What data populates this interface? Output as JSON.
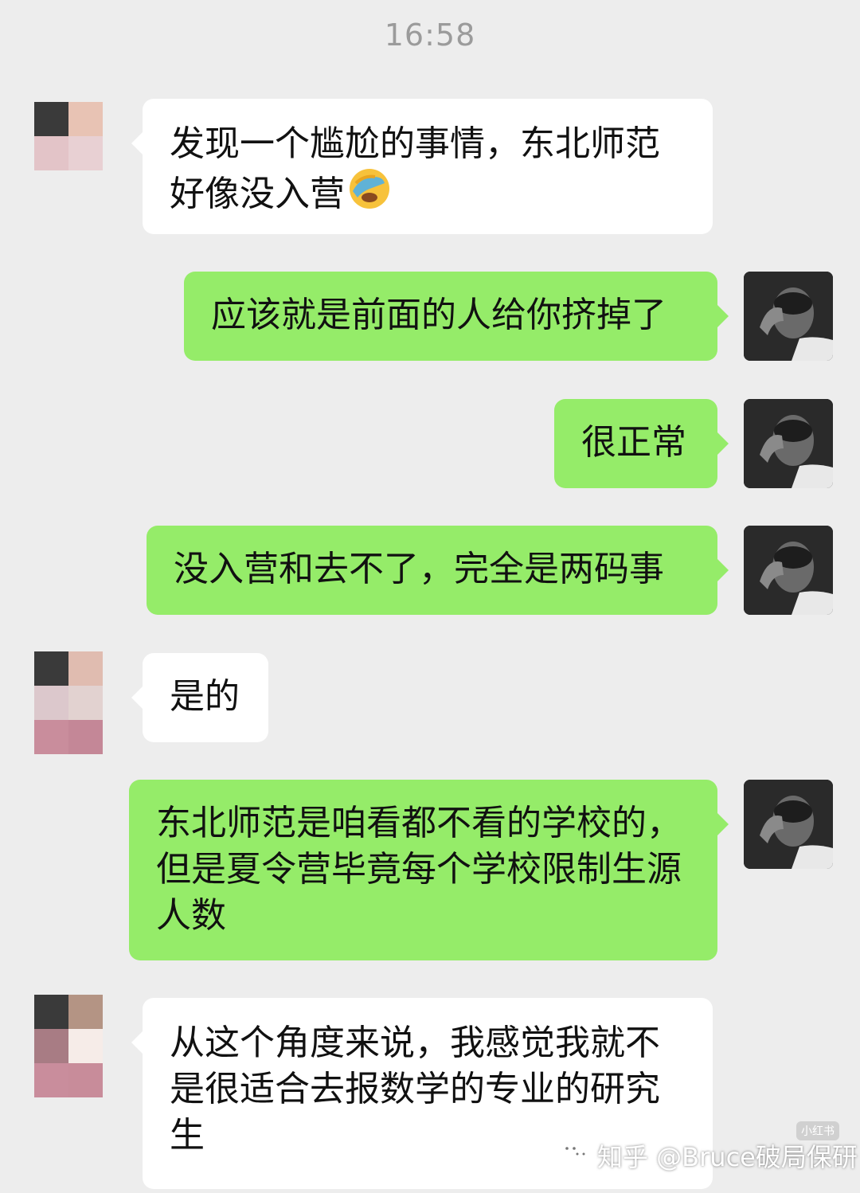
{
  "chat": {
    "timestamp": "16:58",
    "messages": [
      {
        "side": "in",
        "text": "发现一个尴尬的事情，东北师范好像没入营",
        "emoji": "facepalm-emoji"
      },
      {
        "side": "out",
        "text": "应该就是前面的人给你挤掉了"
      },
      {
        "side": "out",
        "text": "很正常"
      },
      {
        "side": "out",
        "text": "没入营和去不了，完全是两码事"
      },
      {
        "side": "in",
        "text": "是的"
      },
      {
        "side": "out",
        "text": "东北师范是咱看都不看的学校的，但是夏令营毕竟每个学校限制生源人数"
      },
      {
        "side": "in",
        "text": "从这个角度来说，我感觉我就不是很适合去报数学的专业的研究生"
      }
    ]
  },
  "watermark": {
    "text": "知乎 @Bruce破局保研",
    "badge": "小红书",
    "icon": "wechat-icon"
  },
  "colors": {
    "background": "#ededed",
    "incoming_bubble": "#ffffff",
    "outgoing_bubble": "#95ec69",
    "timestamp": "#9b9b9b"
  }
}
